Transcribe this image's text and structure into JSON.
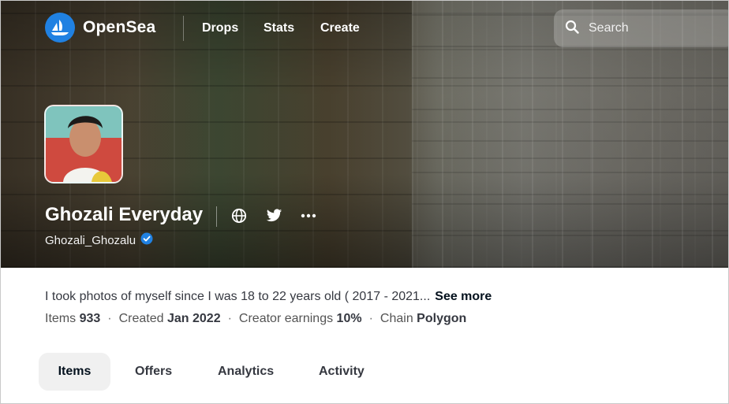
{
  "header": {
    "brand": "OpenSea",
    "nav": [
      "Drops",
      "Stats",
      "Create"
    ],
    "search_placeholder": "Search"
  },
  "collection": {
    "name": "Ghozali Everyday",
    "creator": "Ghozali_Ghozalu",
    "description": "I took photos of myself since I was 18 to 22 years old ( 2017 - 2021...",
    "see_more": "See more",
    "stats": {
      "items_label": "Items",
      "items_value": "933",
      "created_label": "Created",
      "created_value": "Jan 2022",
      "earnings_label": "Creator earnings",
      "earnings_value": "10%",
      "chain_label": "Chain",
      "chain_value": "Polygon",
      "separator": "·"
    }
  },
  "tabs": [
    "Items",
    "Offers",
    "Analytics",
    "Activity"
  ],
  "icons": [
    "opensea-logo-icon",
    "search-icon",
    "globe-icon",
    "twitter-icon",
    "more-icon",
    "verified-badge-icon"
  ],
  "colors": {
    "brand": "#2081e2",
    "text": "#353840",
    "tab_active_bg": "#f0f0f0"
  }
}
